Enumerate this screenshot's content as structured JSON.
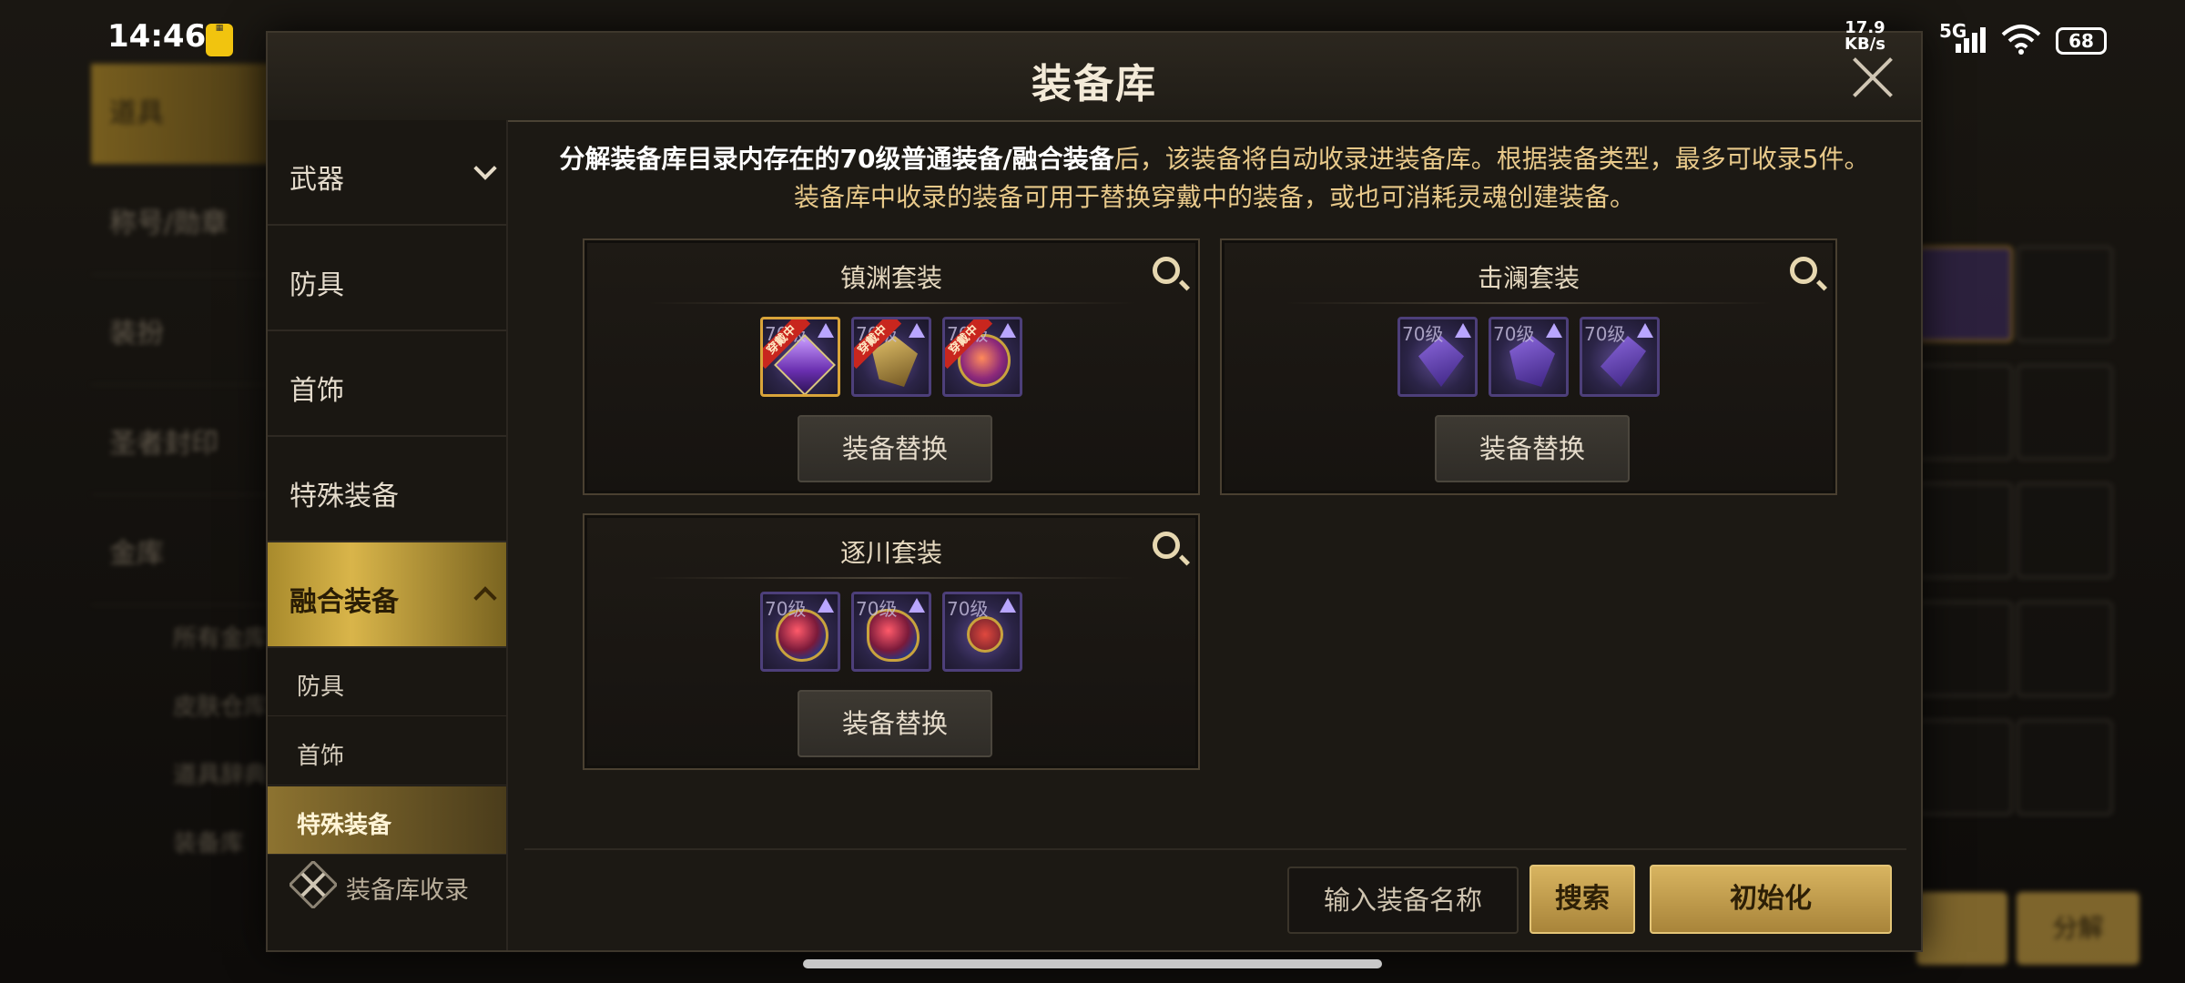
{
  "status_bar": {
    "time": "14:46",
    "net_speed_value": "17.9",
    "net_speed_unit": "KB/s",
    "signal_label": "5G",
    "battery": "68"
  },
  "background": {
    "left_tabs": [
      "道具",
      "称号/勋章",
      "装扮",
      "圣者封印",
      "金库"
    ],
    "left_subs": [
      "所有金库",
      "皮肤仓库",
      "道具辞典",
      "装备库"
    ],
    "right_buttons": [
      "分解"
    ]
  },
  "modal": {
    "title": "装备库",
    "description_bold": "分解装备库目录内存在的70级普通装备/融合装备",
    "description_rest": "后，该装备将自动收录进装备库。根据装备类型，最多可收录5件。",
    "description_line2": "装备库中收录的装备可用于替换穿戴中的装备，或也可消耗灵魂创建装备。",
    "sidebar": {
      "categories": [
        {
          "label": "武器"
        },
        {
          "label": "防具"
        },
        {
          "label": "首饰"
        },
        {
          "label": "特殊装备"
        },
        {
          "label": "融合装备"
        }
      ],
      "subcategories": [
        {
          "label": "防具"
        },
        {
          "label": "首饰"
        },
        {
          "label": "特殊装备"
        }
      ],
      "collection_label": "装备库收录"
    },
    "sets": [
      {
        "name": "镇渊套装",
        "swap_label": "装备替换",
        "items": [
          {
            "level": "70级",
            "ribbon": "穿戴中"
          },
          {
            "level": "70级",
            "ribbon": "穿戴中"
          },
          {
            "level": "70级",
            "ribbon": "穿戴中"
          }
        ]
      },
      {
        "name": "击澜套装",
        "swap_label": "装备替换",
        "items": [
          {
            "level": "70级"
          },
          {
            "level": "70级"
          },
          {
            "level": "70级"
          }
        ]
      },
      {
        "name": "逐川套装",
        "swap_label": "装备替换",
        "items": [
          {
            "level": "70级"
          },
          {
            "level": "70级"
          },
          {
            "level": "70级"
          }
        ]
      }
    ],
    "search_placeholder": "输入装备名称",
    "search_button": "搜索",
    "reset_button": "初始化"
  },
  "colors": {
    "gold_accent": "#d8b460",
    "text_highlight": "#e8c98a",
    "equipped_ribbon": "#c8261e",
    "item_border": "#4d3f7a"
  }
}
